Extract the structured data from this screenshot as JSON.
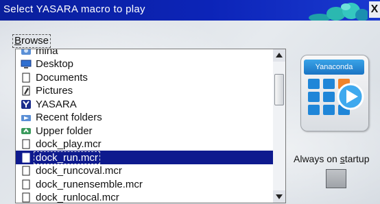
{
  "window": {
    "title": "Select YASARA macro to play",
    "close_glyph": "X"
  },
  "browse": {
    "prefix": "",
    "underlined": "B",
    "rest": "rowse"
  },
  "list": {
    "items": [
      {
        "label": "mina",
        "icon": "folder-user-icon"
      },
      {
        "label": "Desktop",
        "icon": "desktop-icon"
      },
      {
        "label": "Documents",
        "icon": "document-icon"
      },
      {
        "label": "Pictures",
        "icon": "pictures-icon"
      },
      {
        "label": "YASARA",
        "icon": "yasara-icon"
      },
      {
        "label": "Recent folders",
        "icon": "recent-folders-icon"
      },
      {
        "label": "Upper folder",
        "icon": "upper-folder-icon"
      },
      {
        "label": "dock_play.mcr",
        "icon": "file-icon"
      },
      {
        "label": "dock_run.mcr",
        "icon": "file-icon",
        "selected": true
      },
      {
        "label": "dock_runcoval.mcr",
        "icon": "file-icon"
      },
      {
        "label": "dock_runensemble.mcr",
        "icon": "file-icon"
      },
      {
        "label": "dock_runlocal.mcr",
        "icon": "file-icon"
      }
    ]
  },
  "logo": {
    "text": "Yanaconda"
  },
  "startup": {
    "prefix": "Always on ",
    "underlined": "s",
    "rest": "tartup"
  },
  "colors": {
    "titlebar": "#0c24b8",
    "selection": "#0e1a8e"
  }
}
